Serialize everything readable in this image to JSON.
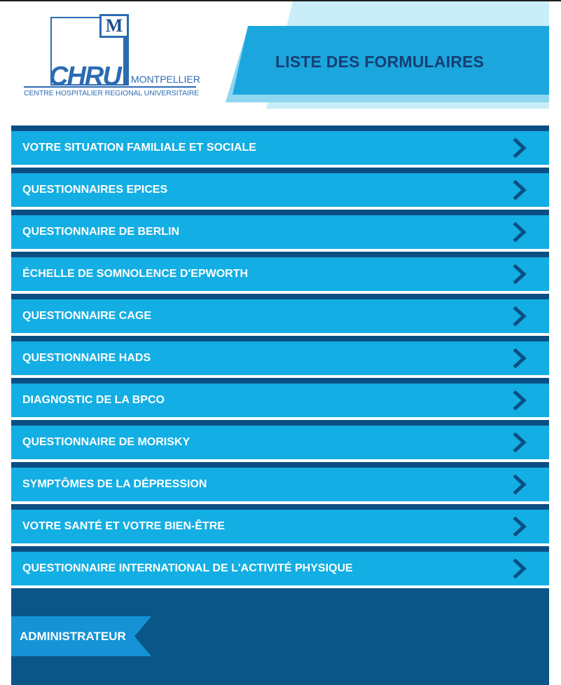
{
  "logo": {
    "letter": "M",
    "brand": "CHRU",
    "city": "MONTPELLIER",
    "subtitle": "CENTRE HOSPITALIER REGIONAL UNIVERSITAIRE"
  },
  "header": {
    "title": "LISTE DES FORMULAIRES"
  },
  "forms": [
    {
      "label": "VOTRE SITUATION FAMILIALE ET SOCIALE",
      "icon": "chevron-right-icon"
    },
    {
      "label": "QUESTIONNAIRES EPICES",
      "icon": "chevron-right-icon"
    },
    {
      "label": "QUESTIONNAIRE DE BERLIN",
      "icon": "chevron-right-icon"
    },
    {
      "label": "ÉCHELLE DE SOMNOLENCE D'EPWORTH",
      "icon": "chevron-right-icon"
    },
    {
      "label": "QUESTIONNAIRE CAGE",
      "icon": "chevron-right-icon"
    },
    {
      "label": "QUESTIONNAIRE HADS",
      "icon": "chevron-right-icon"
    },
    {
      "label": "DIAGNOSTIC DE LA BPCO",
      "icon": "chevron-right-icon"
    },
    {
      "label": "QUESTIONNAIRE DE MORISKY",
      "icon": "chevron-right-icon"
    },
    {
      "label": "SYMPTÔMES DE LA DÉPRESSION",
      "icon": "chevron-right-icon"
    },
    {
      "label": "VOTRE SANTÉ ET VOTRE BIEN-ÊTRE",
      "icon": "chevron-right-icon"
    },
    {
      "label": "QUESTIONNAIRE INTERNATIONAL DE L'ACTIVITÉ PHYSIQUE",
      "icon": "chevron-right-icon"
    }
  ],
  "footer": {
    "admin_label": "ADMINISTRATEUR"
  },
  "colors": {
    "navy": "#0b4e83",
    "item_blue": "#13aee3",
    "title_text": "#173e73",
    "logo_blue": "#2c6bb3",
    "admin_blue": "#1593d6"
  }
}
